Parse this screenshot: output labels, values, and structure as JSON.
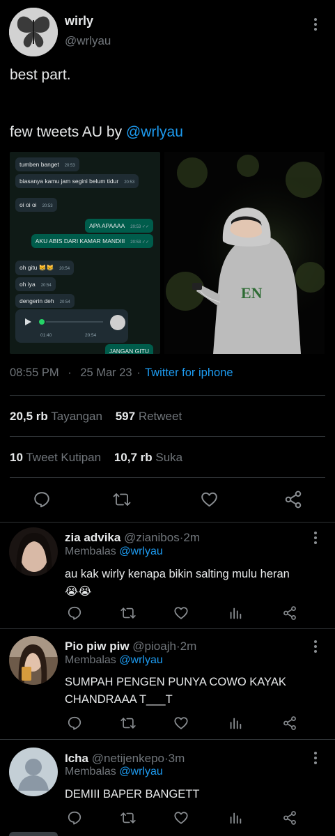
{
  "tweet": {
    "author_name": "wirly",
    "author_handle": "@wrlyau",
    "text_line1": "best part.",
    "text_line2_prefix": "few tweets AU by ",
    "text_line2_mention": "@wrlyau",
    "time": "08:55 PM",
    "sep1": "·",
    "date": "25 Mar 23",
    "sep2": "·",
    "source": "Twitter for iphone",
    "views_count": "20,5 rb",
    "views_label": "Tayangan",
    "retweets_count": "597",
    "retweets_label": "Retweet",
    "quotes_count": "10",
    "quotes_label": "Tweet Kutipan",
    "likes_count": "10,7 rb",
    "likes_label": "Suka"
  },
  "chat_screenshot": {
    "messages": [
      {
        "text": "tumben banget",
        "time": "20:53",
        "dir": "in"
      },
      {
        "text": "biasanya kamu jam segini belum tidur",
        "time": "20:53",
        "dir": "in"
      },
      {
        "text": "oi oi oi",
        "time": "20:53",
        "dir": "in"
      },
      {
        "text": "APA APAAAA",
        "time": "20:53 ✓✓",
        "dir": "out"
      },
      {
        "text": "AKU ABIS DARI KAMAR MANDIII",
        "time": "20:53 ✓✓",
        "dir": "out"
      },
      {
        "text": "oh gitu 😸😸",
        "time": "20:54",
        "dir": "in"
      },
      {
        "text": "oh iya",
        "time": "20:54",
        "dir": "in"
      },
      {
        "text": "dengerin deh",
        "time": "20:54",
        "dir": "in"
      },
      {
        "text": "JANGAN GITU",
        "time": "",
        "dir": "out"
      }
    ],
    "voice_duration": "01:40",
    "voice_time": "20:54"
  },
  "replies": [
    {
      "name": "zia advika",
      "handle": "@zianibos",
      "dot": "·",
      "age": "2m",
      "replying_label": "Membalas",
      "replying_to": "@wrlyau",
      "text": "au kak wirly kenapa bikin salting mulu heran",
      "emoji": "😭😭"
    },
    {
      "name": "Pio piw piw",
      "handle": "@pioajh",
      "dot": "·",
      "age": "2m",
      "replying_label": "Membalas",
      "replying_to": "@wrlyau",
      "text": "SUMPAH PENGEN PUNYA COWO KAYAK CHANDRAAA T___T"
    },
    {
      "name": "Icha",
      "handle": "@netijenkepo",
      "dot": "·",
      "age": "3m",
      "replying_label": "Membalas",
      "replying_to": "@wrlyau",
      "text": "DEMIII BAPER BANGETT"
    }
  ],
  "colors": {
    "background": "#000000",
    "text": "#e7e9ea",
    "muted": "#71767b",
    "accent": "#1d9bf0",
    "divider": "#2f3336"
  }
}
